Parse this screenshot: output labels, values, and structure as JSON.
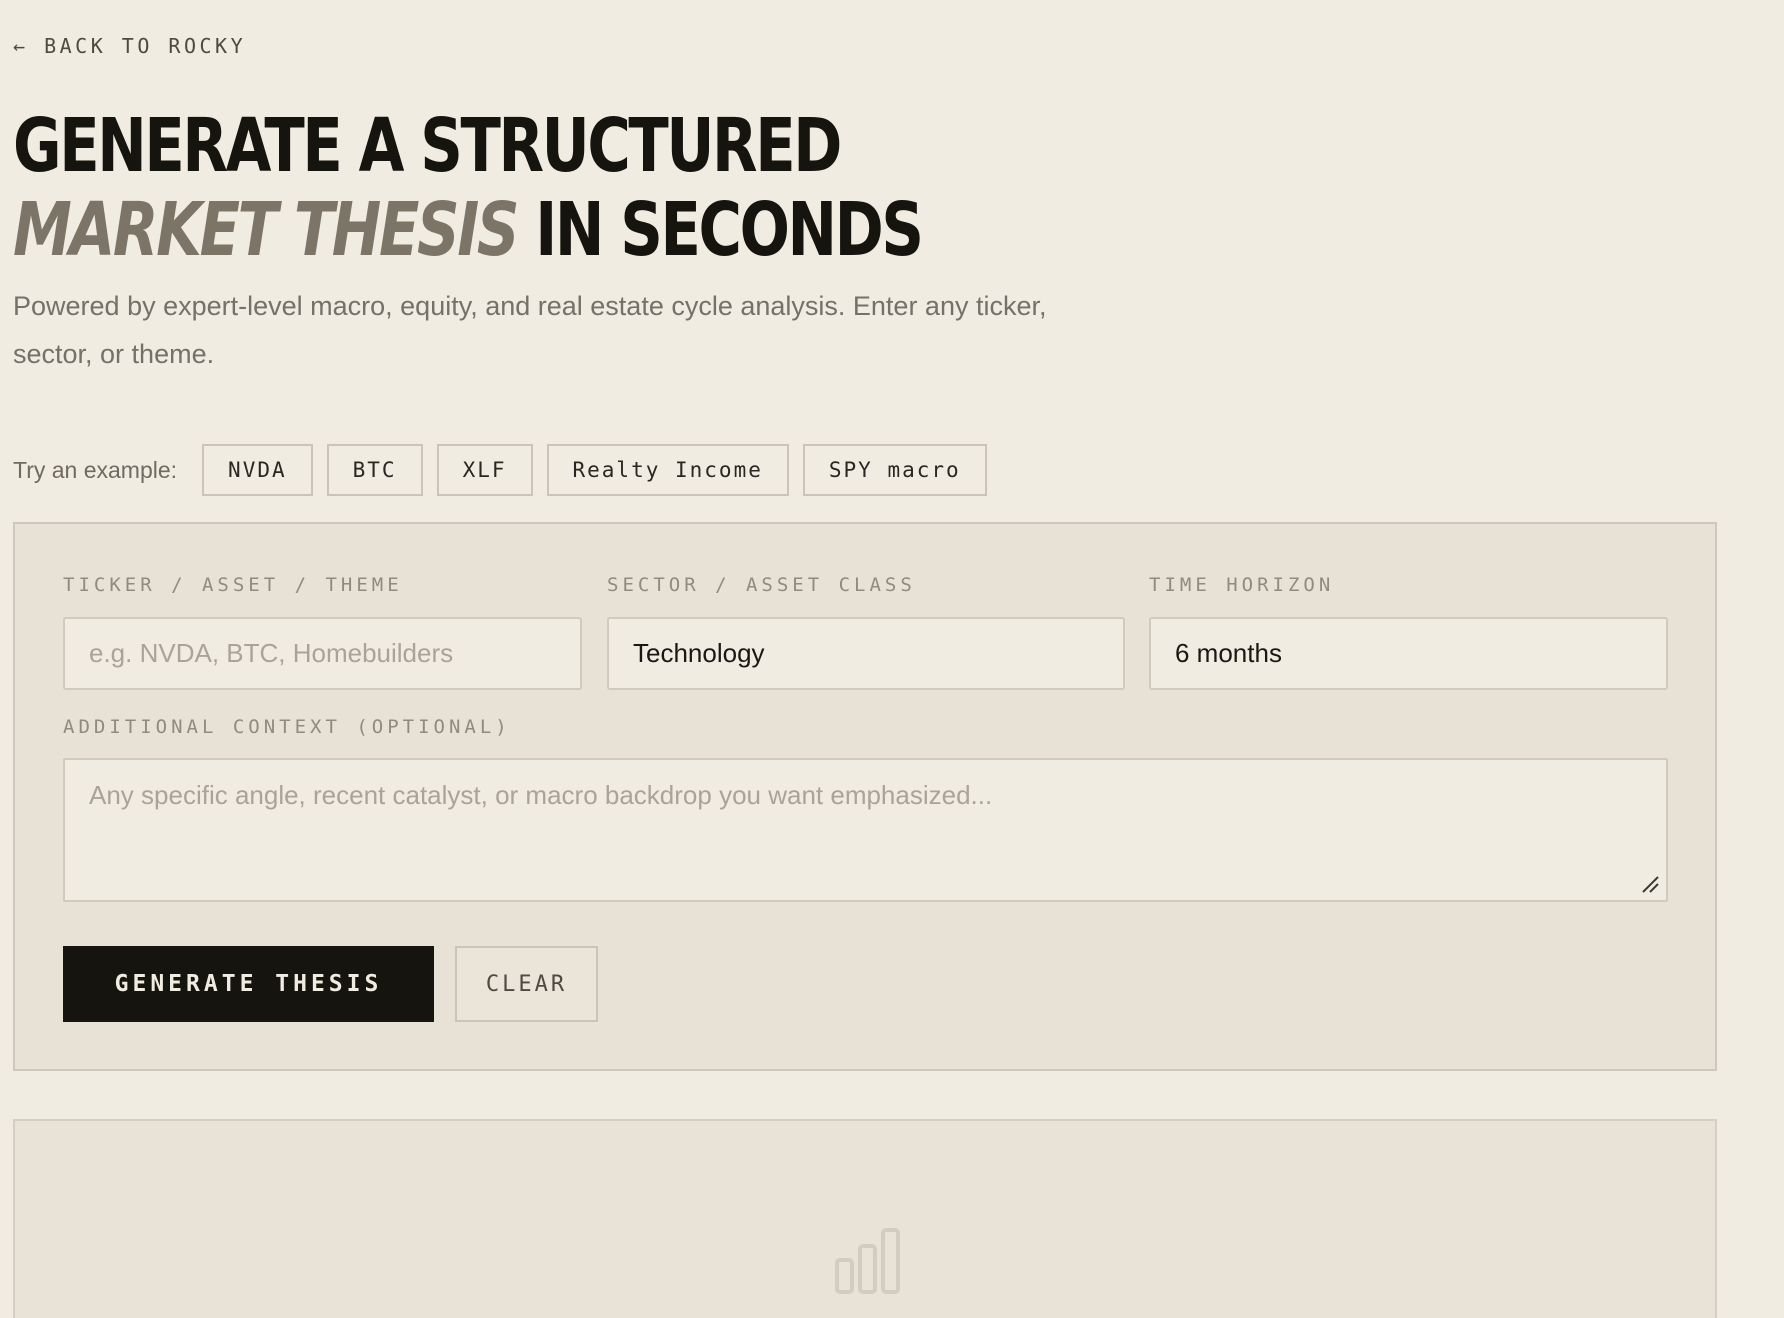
{
  "back": {
    "arrow": "←",
    "label": "BACK TO ROCKY"
  },
  "hero": {
    "line1": "GENERATE A STRUCTURED",
    "accent": "MARKET THESIS",
    "line2_rest": " IN SECONDS",
    "lead": "Powered by expert-level macro, equity, and real estate cycle analysis. Enter any ticker, sector, or theme."
  },
  "examples": {
    "label": "Try an example:",
    "chips": [
      "NVDA",
      "BTC",
      "XLF",
      "Realty Income",
      "SPY macro"
    ]
  },
  "form": {
    "ticker": {
      "label": "TICKER / ASSET / THEME",
      "value": "",
      "placeholder": "e.g. NVDA, BTC, Homebuilders"
    },
    "sector": {
      "label": "SECTOR / ASSET CLASS",
      "value": "Technology"
    },
    "horizon": {
      "label": "TIME HORIZON",
      "value": "6 months"
    },
    "context": {
      "label": "ADDITIONAL CONTEXT (OPTIONAL)",
      "value": "",
      "placeholder": "Any specific angle, recent catalyst, or macro backdrop you want emphasized..."
    },
    "generate_label": "GENERATE THESIS",
    "clear_label": "CLEAR"
  },
  "output": {
    "icon": "bar-chart-icon"
  },
  "colors": {
    "background": "#f1ece2",
    "panel": "#e8e1d6",
    "ink": "#16140f",
    "accent_muted": "#7b7467",
    "border": "#cfc8bc"
  }
}
